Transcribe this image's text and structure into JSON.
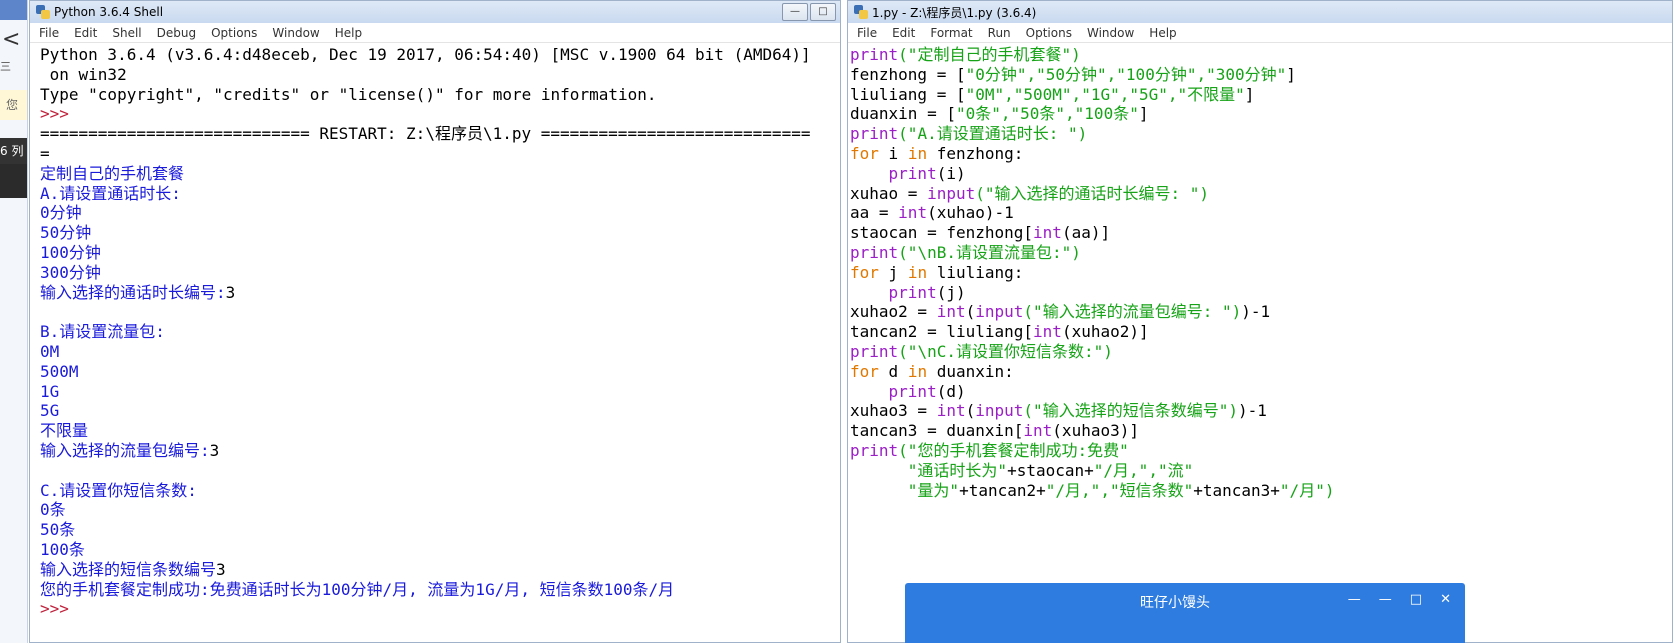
{
  "left_pane": {
    "back_glyph": "<",
    "dots_glyph": "三",
    "note_text": "您",
    "status_text": "6 列"
  },
  "shell": {
    "title": "Python 3.6.4 Shell",
    "window_buttons": [
      "—",
      "□"
    ],
    "menu": [
      "File",
      "Edit",
      "Shell",
      "Debug",
      "Options",
      "Window",
      "Help"
    ],
    "lines": [
      [
        {
          "t": "Python 3.6.4 (v3.6.4:d48eceb, Dec 19 2017, 06:54:40) [MSC v.1900 64 bit (AMD64)]",
          "c": "blk"
        }
      ],
      [
        {
          "t": " on win32",
          "c": "blk"
        }
      ],
      [
        {
          "t": "Type \"copyright\", \"credits\" or \"license()\" for more information.",
          "c": "blk"
        }
      ],
      [
        {
          "t": ">>>",
          "c": "red"
        }
      ],
      [
        {
          "t": "============================ RESTART: Z:\\程序员\\1.py ============================",
          "c": "blk"
        }
      ],
      [
        {
          "t": "=",
          "c": "blk"
        }
      ],
      [
        {
          "t": "定制自己的手机套餐",
          "c": "blu"
        }
      ],
      [
        {
          "t": "A.请设置通话时长:",
          "c": "blu"
        }
      ],
      [
        {
          "t": "0分钟",
          "c": "blu"
        }
      ],
      [
        {
          "t": "50分钟",
          "c": "blu"
        }
      ],
      [
        {
          "t": "100分钟",
          "c": "blu"
        }
      ],
      [
        {
          "t": "300分钟",
          "c": "blu"
        }
      ],
      [
        {
          "t": "输入选择的通话时长编号:",
          "c": "blu"
        },
        {
          "t": "3",
          "c": "blk"
        }
      ],
      [
        {
          "t": "",
          "c": "blk"
        }
      ],
      [
        {
          "t": "B.请设置流量包:",
          "c": "blu"
        }
      ],
      [
        {
          "t": "0M",
          "c": "blu"
        }
      ],
      [
        {
          "t": "500M",
          "c": "blu"
        }
      ],
      [
        {
          "t": "1G",
          "c": "blu"
        }
      ],
      [
        {
          "t": "5G",
          "c": "blu"
        }
      ],
      [
        {
          "t": "不限量",
          "c": "blu"
        }
      ],
      [
        {
          "t": "输入选择的流量包编号:",
          "c": "blu"
        },
        {
          "t": "3",
          "c": "blk"
        }
      ],
      [
        {
          "t": "",
          "c": "blk"
        }
      ],
      [
        {
          "t": "C.请设置你短信条数:",
          "c": "blu"
        }
      ],
      [
        {
          "t": "0条",
          "c": "blu"
        }
      ],
      [
        {
          "t": "50条",
          "c": "blu"
        }
      ],
      [
        {
          "t": "100条",
          "c": "blu"
        }
      ],
      [
        {
          "t": "输入选择的短信条数编号",
          "c": "blu"
        },
        {
          "t": "3",
          "c": "blk"
        }
      ],
      [
        {
          "t": "您的手机套餐定制成功:免费通话时长为100分钟/月, 流量为1G/月, 短信条数100条/月",
          "c": "blu"
        }
      ],
      [
        {
          "t": ">>>",
          "c": "red"
        }
      ]
    ]
  },
  "editor": {
    "title": "1.py - Z:\\程序员\\1.py (3.6.4)",
    "menu": [
      "File",
      "Edit",
      "Format",
      "Run",
      "Options",
      "Window",
      "Help"
    ],
    "lines": [
      [
        {
          "t": "print",
          "c": "prp"
        },
        {
          "t": "(\"定制自己的手机套餐\")",
          "c": "grn"
        }
      ],
      [
        {
          "t": "fenzhong = [",
          "c": "blk"
        },
        {
          "t": "\"0分钟\",\"50分钟\",\"100分钟\",\"300分钟\"",
          "c": "grn"
        },
        {
          "t": "]",
          "c": "blk"
        }
      ],
      [
        {
          "t": "liuliang = [",
          "c": "blk"
        },
        {
          "t": "\"0M\",\"500M\",\"1G\",\"5G\",\"不限量\"",
          "c": "grn"
        },
        {
          "t": "]",
          "c": "blk"
        }
      ],
      [
        {
          "t": "duanxin = [",
          "c": "blk"
        },
        {
          "t": "\"0条\",\"50条\",\"100条\"",
          "c": "grn"
        },
        {
          "t": "]",
          "c": "blk"
        }
      ],
      [
        {
          "t": "print",
          "c": "prp"
        },
        {
          "t": "(\"A.请设置通话时长: \")",
          "c": "grn"
        }
      ],
      [
        {
          "t": "for",
          "c": "org"
        },
        {
          "t": " i ",
          "c": "blk"
        },
        {
          "t": "in",
          "c": "org"
        },
        {
          "t": " fenzhong:",
          "c": "blk"
        }
      ],
      [
        {
          "t": "    ",
          "c": "blk"
        },
        {
          "t": "print",
          "c": "prp"
        },
        {
          "t": "(i)",
          "c": "blk"
        }
      ],
      [
        {
          "t": "xuhao = ",
          "c": "blk"
        },
        {
          "t": "input",
          "c": "prp"
        },
        {
          "t": "(\"输入选择的通话时长编号: \")",
          "c": "grn"
        }
      ],
      [
        {
          "t": "aa = ",
          "c": "blk"
        },
        {
          "t": "int",
          "c": "prp"
        },
        {
          "t": "(xuhao)-1",
          "c": "blk"
        }
      ],
      [
        {
          "t": "staocan = fenzhong[",
          "c": "blk"
        },
        {
          "t": "int",
          "c": "prp"
        },
        {
          "t": "(aa)]",
          "c": "blk"
        }
      ],
      [
        {
          "t": "print",
          "c": "prp"
        },
        {
          "t": "(\"\\nB.请设置流量包:\")",
          "c": "grn"
        }
      ],
      [
        {
          "t": "for",
          "c": "org"
        },
        {
          "t": " j ",
          "c": "blk"
        },
        {
          "t": "in",
          "c": "org"
        },
        {
          "t": " liuliang:",
          "c": "blk"
        }
      ],
      [
        {
          "t": "    ",
          "c": "blk"
        },
        {
          "t": "print",
          "c": "prp"
        },
        {
          "t": "(j)",
          "c": "blk"
        }
      ],
      [
        {
          "t": "xuhao2 = ",
          "c": "blk"
        },
        {
          "t": "int",
          "c": "prp"
        },
        {
          "t": "(",
          "c": "blk"
        },
        {
          "t": "input",
          "c": "prp"
        },
        {
          "t": "(\"输入选择的流量包编号: \")",
          "c": "grn"
        },
        {
          "t": ")-1",
          "c": "blk"
        }
      ],
      [
        {
          "t": "tancan2 = liuliang[",
          "c": "blk"
        },
        {
          "t": "int",
          "c": "prp"
        },
        {
          "t": "(xuhao2)]",
          "c": "blk"
        }
      ],
      [
        {
          "t": "print",
          "c": "prp"
        },
        {
          "t": "(\"\\nC.请设置你短信条数:\")",
          "c": "grn"
        }
      ],
      [
        {
          "t": "for",
          "c": "org"
        },
        {
          "t": " d ",
          "c": "blk"
        },
        {
          "t": "in",
          "c": "org"
        },
        {
          "t": " duanxin:",
          "c": "blk"
        }
      ],
      [
        {
          "t": "    ",
          "c": "blk"
        },
        {
          "t": "print",
          "c": "prp"
        },
        {
          "t": "(d)",
          "c": "blk"
        }
      ],
      [
        {
          "t": "xuhao3 = ",
          "c": "blk"
        },
        {
          "t": "int",
          "c": "prp"
        },
        {
          "t": "(",
          "c": "blk"
        },
        {
          "t": "input",
          "c": "prp"
        },
        {
          "t": "(\"输入选择的短信条数编号\")",
          "c": "grn"
        },
        {
          "t": ")-1",
          "c": "blk"
        }
      ],
      [
        {
          "t": "tancan3 = duanxin[",
          "c": "blk"
        },
        {
          "t": "int",
          "c": "prp"
        },
        {
          "t": "(xuhao3)]",
          "c": "blk"
        }
      ],
      [
        {
          "t": "print",
          "c": "prp"
        },
        {
          "t": "(\"您的手机套餐定制成功:免费\"",
          "c": "grn"
        }
      ],
      [
        {
          "t": "      \"通话时长为\"",
          "c": "grn"
        },
        {
          "t": "+staocan+",
          "c": "blk"
        },
        {
          "t": "\"/月,\",\"流\"",
          "c": "grn"
        }
      ],
      [
        {
          "t": "      \"量为\"",
          "c": "grn"
        },
        {
          "t": "+tancan2+",
          "c": "blk"
        },
        {
          "t": "\"/月,\",\"短信条数\"",
          "c": "grn"
        },
        {
          "t": "+tancan3+",
          "c": "blk"
        },
        {
          "t": "\"/月\")",
          "c": "grn"
        }
      ]
    ]
  },
  "popup": {
    "title": "旺仔小馒头",
    "buttons": [
      "—",
      "—",
      "□",
      "✕"
    ]
  }
}
